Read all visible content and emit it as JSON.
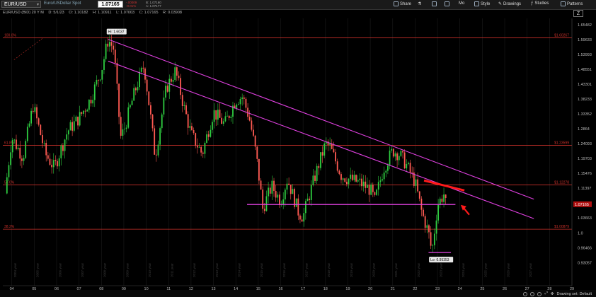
{
  "toolbar": {
    "symbol": "EUR/USD",
    "description": "Euro/USDollar Spot",
    "last_price": "1.07165",
    "change_line1": "-.00009",
    "change_line2": "-0.01%",
    "bid_line1": "B: 1.07160",
    "bid_line2": "A: 1.07177",
    "share": "Share",
    "mo": "Mo",
    "style": "Style",
    "drawings": "Drawings",
    "studies": "Studies",
    "patterns": "Patterns",
    "zoom_label": "Z"
  },
  "info": {
    "name": "EUR/USD (BID) 20 Y M",
    "date": "D: 5/1/23",
    "open": "O: 1.10182",
    "high": "H: 1.10911",
    "low": "L: 1.07003",
    "close": "C: 1.07165",
    "range": "R: 0.03908"
  },
  "footer": {
    "drawing_set": "Drawing set: Default"
  },
  "colors": {
    "up": "#2ecc40",
    "down": "#ff5a52",
    "trendline": "#e040e0",
    "fib": "#c8302a",
    "arrow": "#ff1a1a"
  },
  "chart_data": {
    "type": "candlestick",
    "y_scale": "log",
    "ylim": [
      0.88,
      1.68
    ],
    "y_ticks": [
      "1.65482",
      "1.59633",
      "1.53993",
      "1.48551",
      "1.43301",
      "1.38233",
      "1.33352",
      "1.2864",
      "1.24093",
      "1.19703",
      "1.15476",
      "1.11397",
      "1.07165",
      "1.03663",
      "1.0",
      "0.96466",
      "0.93057"
    ],
    "x_range": [
      2003.6,
      2029.0
    ],
    "x_ticks": [
      {
        "label": "04",
        "t": 2004
      },
      {
        "label": "05",
        "t": 2005
      },
      {
        "label": "06",
        "t": 2006
      },
      {
        "label": "07",
        "t": 2007
      },
      {
        "label": "08",
        "t": 2008
      },
      {
        "label": "09",
        "t": 2009
      },
      {
        "label": "10",
        "t": 2010
      },
      {
        "label": "11",
        "t": 2011
      },
      {
        "label": "12",
        "t": 2012
      },
      {
        "label": "13",
        "t": 2013
      },
      {
        "label": "14",
        "t": 2014
      },
      {
        "label": "15",
        "t": 2015
      },
      {
        "label": "16",
        "t": 2016
      },
      {
        "label": "17",
        "t": 2017
      },
      {
        "label": "18",
        "t": 2018
      },
      {
        "label": "19",
        "t": 2019
      },
      {
        "label": "20",
        "t": 2020
      },
      {
        "label": "21",
        "t": 2021
      },
      {
        "label": "22",
        "t": 2022
      },
      {
        "label": "23",
        "t": 2023
      },
      {
        "label": "24",
        "t": 2024
      },
      {
        "label": "25",
        "t": 2025
      },
      {
        "label": "26",
        "t": 2026
      },
      {
        "label": "27",
        "t": 2027
      },
      {
        "label": "28",
        "t": 2028
      },
      {
        "label": "29",
        "t": 2029
      }
    ],
    "year_labels": [
      {
        "label": "2003 year",
        "t": 2003.2
      },
      {
        "label": "2004 year",
        "t": 2004.2
      },
      {
        "label": "2005 year",
        "t": 2005.2
      },
      {
        "label": "2006 year",
        "t": 2006.2
      },
      {
        "label": "2007 year",
        "t": 2007.2
      },
      {
        "label": "2008 year",
        "t": 2008.2
      },
      {
        "label": "2009 year",
        "t": 2009.2
      },
      {
        "label": "2010 year",
        "t": 2010.2
      },
      {
        "label": "2011 year",
        "t": 2011.2
      },
      {
        "label": "2012 year",
        "t": 2012.2
      },
      {
        "label": "2013 year",
        "t": 2013.2
      },
      {
        "label": "2014 year",
        "t": 2014.2
      },
      {
        "label": "2015 year",
        "t": 2015.2
      },
      {
        "label": "2016 year",
        "t": 2016.2
      },
      {
        "label": "2017 year",
        "t": 2017.2
      },
      {
        "label": "2018 year",
        "t": 2018.2
      },
      {
        "label": "2019 year",
        "t": 2019.2
      },
      {
        "label": "2020 year",
        "t": 2020.2
      },
      {
        "label": "2021 year",
        "t": 2021.2
      },
      {
        "label": "2022 year",
        "t": 2022.2
      },
      {
        "label": "2023 year",
        "t": 2023.2
      },
      {
        "label": "2024 year",
        "t": 2024.2
      },
      {
        "label": "2025 year",
        "t": 2025.2
      },
      {
        "label": "2026 year",
        "t": 2026.2
      },
      {
        "label": "2027 year",
        "t": 2027.2
      }
    ],
    "price_keypoints": [
      [
        2003.7,
        1.1
      ],
      [
        2004.0,
        1.26
      ],
      [
        2004.5,
        1.2
      ],
      [
        2004.95,
        1.36
      ],
      [
        2005.5,
        1.21
      ],
      [
        2005.9,
        1.17
      ],
      [
        2006.5,
        1.28
      ],
      [
        2007.0,
        1.32
      ],
      [
        2007.5,
        1.38
      ],
      [
        2008.0,
        1.48
      ],
      [
        2008.3,
        1.597
      ],
      [
        2008.55,
        1.56
      ],
      [
        2008.85,
        1.26
      ],
      [
        2009.0,
        1.28
      ],
      [
        2009.5,
        1.41
      ],
      [
        2009.9,
        1.5
      ],
      [
        2010.4,
        1.2
      ],
      [
        2010.9,
        1.42
      ],
      [
        2011.3,
        1.48
      ],
      [
        2011.7,
        1.35
      ],
      [
        2012.0,
        1.27
      ],
      [
        2012.5,
        1.21
      ],
      [
        2013.0,
        1.34
      ],
      [
        2013.5,
        1.3
      ],
      [
        2014.0,
        1.38
      ],
      [
        2014.3,
        1.39
      ],
      [
        2014.6,
        1.32
      ],
      [
        2014.9,
        1.21
      ],
      [
        2015.2,
        1.06
      ],
      [
        2015.6,
        1.12
      ],
      [
        2016.0,
        1.08
      ],
      [
        2016.3,
        1.14
      ],
      [
        2016.8,
        1.05
      ],
      [
        2017.0,
        1.04
      ],
      [
        2017.5,
        1.14
      ],
      [
        2018.0,
        1.24
      ],
      [
        2018.2,
        1.23
      ],
      [
        2018.7,
        1.15
      ],
      [
        2019.0,
        1.14
      ],
      [
        2019.5,
        1.13
      ],
      [
        2020.0,
        1.11
      ],
      [
        2020.2,
        1.08
      ],
      [
        2020.6,
        1.17
      ],
      [
        2021.0,
        1.22
      ],
      [
        2021.3,
        1.21
      ],
      [
        2021.6,
        1.18
      ],
      [
        2022.0,
        1.13
      ],
      [
        2022.3,
        1.05
      ],
      [
        2022.6,
        1.0
      ],
      [
        2022.75,
        0.9535
      ],
      [
        2022.9,
        1.02
      ],
      [
        2023.0,
        1.07
      ],
      [
        2023.3,
        1.1
      ],
      [
        2023.35,
        1.0717
      ]
    ],
    "trendlines": [
      {
        "t1": 2008.3,
        "p1": 1.597,
        "t2": 2027.3,
        "p2": 1.085
      },
      {
        "t1": 2008.3,
        "p1": 1.515,
        "t2": 2027.3,
        "p2": 1.035
      }
    ],
    "support_line": {
      "t1": 2014.5,
      "t2": 2023.8,
      "p": 1.071
    },
    "low_line": {
      "t1": 2022.6,
      "t2": 2023.6,
      "p": 0.9535
    },
    "highlight_line": {
      "t1": 2022.4,
      "t2": 2024.2,
      "p1": 1.135,
      "p2": 1.108
    },
    "fib_levels": [
      {
        "label": "100.0%",
        "price": 1.60267,
        "right_label": "$1.60267"
      },
      {
        "label": "61.8%",
        "price": 1.23599,
        "right_label": "$1.23599"
      },
      {
        "label": "50.0%",
        "price": 1.12278,
        "right_label": "$1.12278"
      },
      {
        "label": "38.2%",
        "price": 1.00879,
        "right_label": "$1.00879"
      }
    ],
    "hi_label": "Hi: 1.6037",
    "lo_label": "Lo: 0.95353",
    "current_label": "1.07165"
  }
}
